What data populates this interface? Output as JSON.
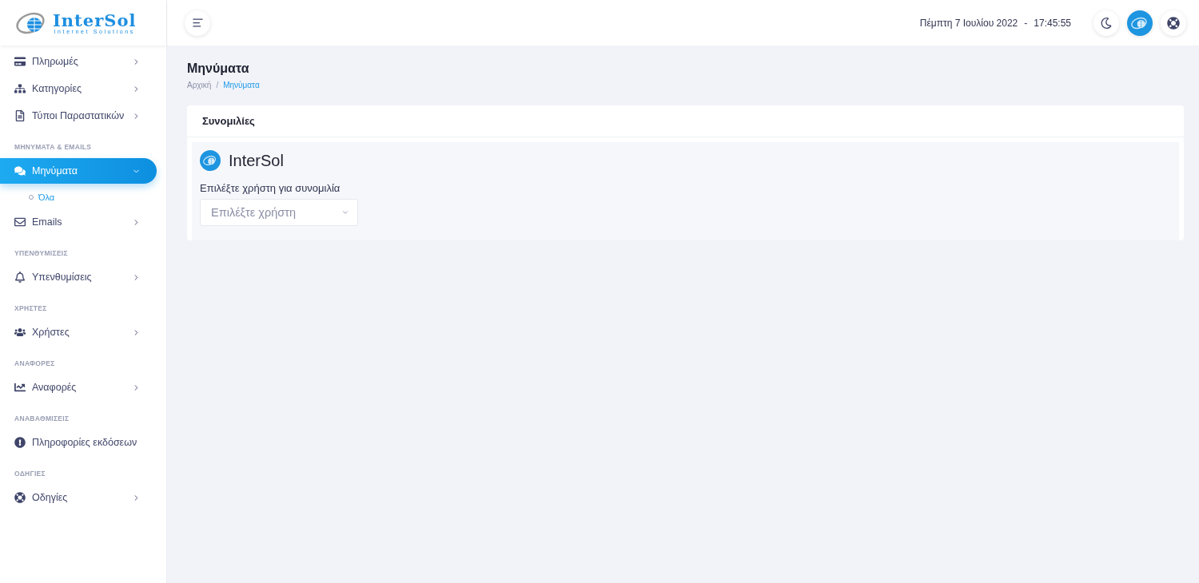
{
  "logo": {
    "name": "InterSol",
    "tagline": "Internet Solutions"
  },
  "sidebar": {
    "items": [
      {
        "kind": "item",
        "label": "Πληρωμές",
        "has_arrow": true,
        "selected": false
      },
      {
        "kind": "item",
        "label": "Κατηγορίες",
        "has_arrow": true,
        "selected": false
      },
      {
        "kind": "item",
        "label": "Τύποι Παραστατικών",
        "has_arrow": true,
        "selected": false
      },
      {
        "kind": "section",
        "label": "ΜΗΝΥΜΑΤΑ & EMAILS"
      },
      {
        "kind": "item",
        "label": "Μηνύματα",
        "has_arrow": true,
        "selected": true,
        "expanded": true,
        "children": [
          {
            "label": "Όλα",
            "selected": true
          }
        ]
      },
      {
        "kind": "item",
        "label": "Emails",
        "has_arrow": true,
        "selected": false
      },
      {
        "kind": "section",
        "label": "ΥΠΕΝΘΥΜΙΣΕΙΣ"
      },
      {
        "kind": "item",
        "label": "Υπενθυμίσεις",
        "has_arrow": true,
        "selected": false
      },
      {
        "kind": "section",
        "label": "ΧΡΗΣΤΕΣ"
      },
      {
        "kind": "item",
        "label": "Χρήστες",
        "has_arrow": true,
        "selected": false
      },
      {
        "kind": "section",
        "label": "ΑΝΑΦΟΡΕΣ"
      },
      {
        "kind": "item",
        "label": "Αναφορές",
        "has_arrow": true,
        "selected": false
      },
      {
        "kind": "section",
        "label": "ΑΝΑΒΑΘΜΙΣΕΙΣ"
      },
      {
        "kind": "item",
        "label": "Πληροφορίες εκδόσεων",
        "has_arrow": false,
        "selected": false
      },
      {
        "kind": "section",
        "label": "ΟΔΗΓΙΕΣ"
      },
      {
        "kind": "item",
        "label": "Οδηγίες",
        "has_arrow": true,
        "selected": false
      }
    ]
  },
  "header": {
    "date": "Πέμπτη 7 Ιουλίου 2022",
    "separator": "-",
    "time": "17:45:55"
  },
  "page": {
    "title": "Μηνύματα",
    "breadcrumb_separator": "/",
    "breadcrumbs": [
      {
        "label": "Αρχική",
        "selected": false
      },
      {
        "label": "Μηνύματα",
        "selected": true
      }
    ]
  },
  "card": {
    "title": "Συνομιλίες",
    "chat_name": "InterSol",
    "field_label": "Επιλέξτε χρήστη για συνομιλία",
    "select": {
      "placeholder": "Επιλέξτε χρήστη"
    }
  }
}
